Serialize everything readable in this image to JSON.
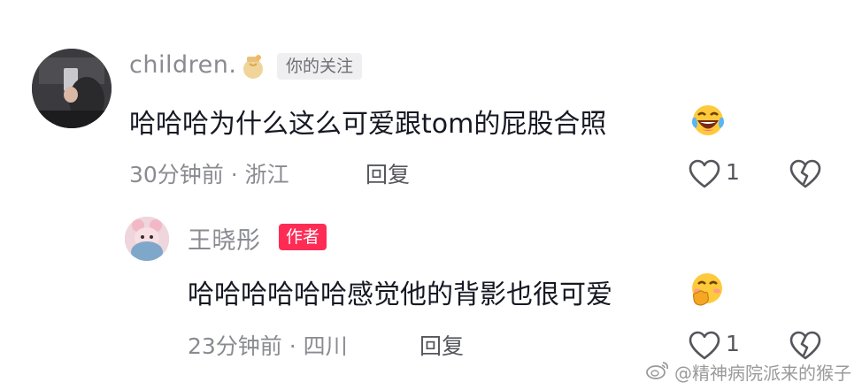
{
  "comment": {
    "username": "children.",
    "username_icon": "honey-jar-icon",
    "badge": "你的关注",
    "text": "哈哈哈为什么这么可爱跟tom的屁股合照",
    "emoji": "laughing-tears-emoji",
    "time_location": "30分钟前 · 浙江",
    "reply_label": "回复",
    "like_count": "1",
    "like_icon": "heart-outline-icon",
    "dislike_icon": "broken-heart-icon"
  },
  "reply": {
    "username": "王晓彤",
    "badge": "作者",
    "text": "哈哈哈哈哈哈感觉他的背影也很可爱",
    "emoji": "giggle-emoji",
    "time_location": "23分钟前 · 四川",
    "reply_label": "回复",
    "like_count": "1",
    "like_icon": "heart-outline-icon",
    "dislike_icon": "broken-heart-icon"
  },
  "watermark": {
    "text": "@精神病院派来的猴子"
  },
  "colors": {
    "author_badge": "#fe2c55",
    "follow_badge_bg": "#efeff1",
    "meta_gray": "#8a8b91",
    "text_dark": "#161823"
  }
}
